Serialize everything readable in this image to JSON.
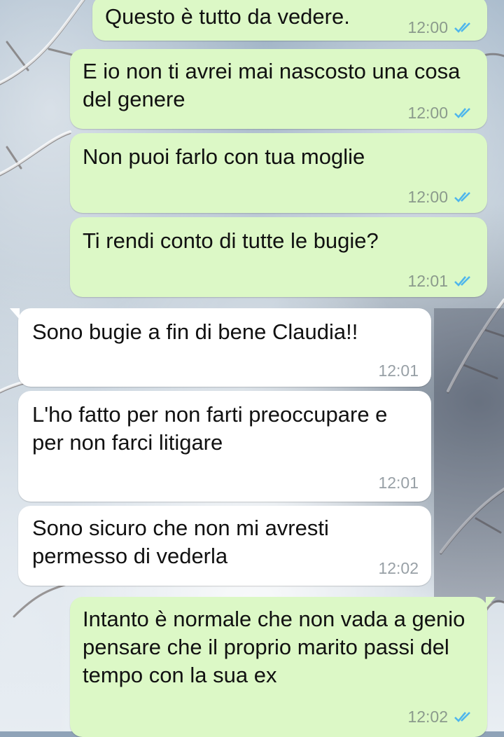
{
  "chat": {
    "messages": [
      {
        "direction": "out",
        "text": "Questo è tutto da vedere.",
        "time": "12:00",
        "status": "read"
      },
      {
        "direction": "out",
        "text": "E io non ti avrei mai nascosto una cosa del genere",
        "time": "12:00",
        "status": "read"
      },
      {
        "direction": "out",
        "text": "Non puoi farlo con tua moglie",
        "time": "12:00",
        "status": "read"
      },
      {
        "direction": "out",
        "text": "Ti rendi conto di tutte le bugie?",
        "time": "12:01",
        "status": "read"
      },
      {
        "direction": "in",
        "text": "Sono bugie a fin di bene Claudia!!",
        "time": "12:01"
      },
      {
        "direction": "in",
        "text": "L'ho fatto per non farti preoccupare e per non farci litigare",
        "time": "12:01"
      },
      {
        "direction": "in",
        "text": "Sono sicuro che non mi avresti permesso di vederla",
        "time": "12:02"
      },
      {
        "direction": "out",
        "text": "Intanto è normale che non vada a genio pensare che il proprio marito passi del tempo con la sua ex",
        "time": "12:02",
        "status": "read"
      }
    ]
  },
  "colors": {
    "outgoing_bubble": "#dcf8c6",
    "incoming_bubble": "#ffffff",
    "read_ticks": "#4fb6ec",
    "timestamp": "#8b9a8c"
  },
  "icons": {
    "read_receipt": "double-check-icon",
    "wallpaper": "snowy-branches-wallpaper"
  }
}
